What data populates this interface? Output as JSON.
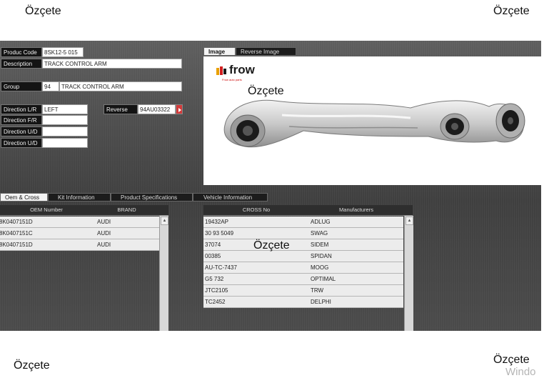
{
  "overlays": {
    "top_left": "Özçete",
    "top_right": "Özçete",
    "image_center": "Özçete",
    "table_center": "Özçete",
    "bottom_left": "Özçete",
    "bottom_right": "Özçete",
    "windows_watermark": "Windo"
  },
  "form": {
    "product_code": {
      "label": "Produc Code",
      "value": "8SK12-5 015"
    },
    "description": {
      "label": "Description",
      "value": "TRACK CONTROL ARM"
    },
    "group": {
      "label": "Group",
      "code": "94",
      "value": "TRACK CONTROL ARM"
    },
    "direction_lr": {
      "label": "Direction L/R",
      "value": "LEFT"
    },
    "direction_fr": {
      "label": "Direction F/R",
      "value": ""
    },
    "direction_ud1": {
      "label": "Direction U/D",
      "value": ""
    },
    "direction_ud2": {
      "label": "Direction U/D",
      "value": ""
    },
    "reverse": {
      "label": "Reverse",
      "value": "94AU03322"
    }
  },
  "image_tabs": {
    "image": "Image",
    "reverse_image": "Reverse Image"
  },
  "logo": {
    "text": "frow",
    "tagline": "Frow auto parts"
  },
  "bottom_tabs": [
    "Oem & Cross",
    "Kit Information",
    "Product Specifications",
    "Vehicle Information"
  ],
  "oem_table": {
    "headers": [
      "OEM Number",
      "BRAND"
    ],
    "rows": [
      [
        "8K0407151D",
        "AUDI"
      ],
      [
        "8K0407151C",
        "AUDI"
      ],
      [
        "8K0407151D",
        "AUDI"
      ]
    ]
  },
  "cross_table": {
    "headers": [
      "CROSS No",
      "Manufacturers"
    ],
    "rows": [
      [
        "19432AP",
        "ADLUG"
      ],
      [
        "30 93 5049",
        "SWAG"
      ],
      [
        "37074",
        "SIDEM"
      ],
      [
        "00385",
        "SPIDAN"
      ],
      [
        "AU-TC-7437",
        "MOOG"
      ],
      [
        "G5 732",
        "OPTIMAL"
      ],
      [
        "JTC2105",
        "TRW"
      ],
      [
        "TC2452",
        "DELPHI"
      ]
    ]
  },
  "colors": {
    "accent_red": "#d23b3b",
    "dark_bg": "#4a4a4a"
  }
}
